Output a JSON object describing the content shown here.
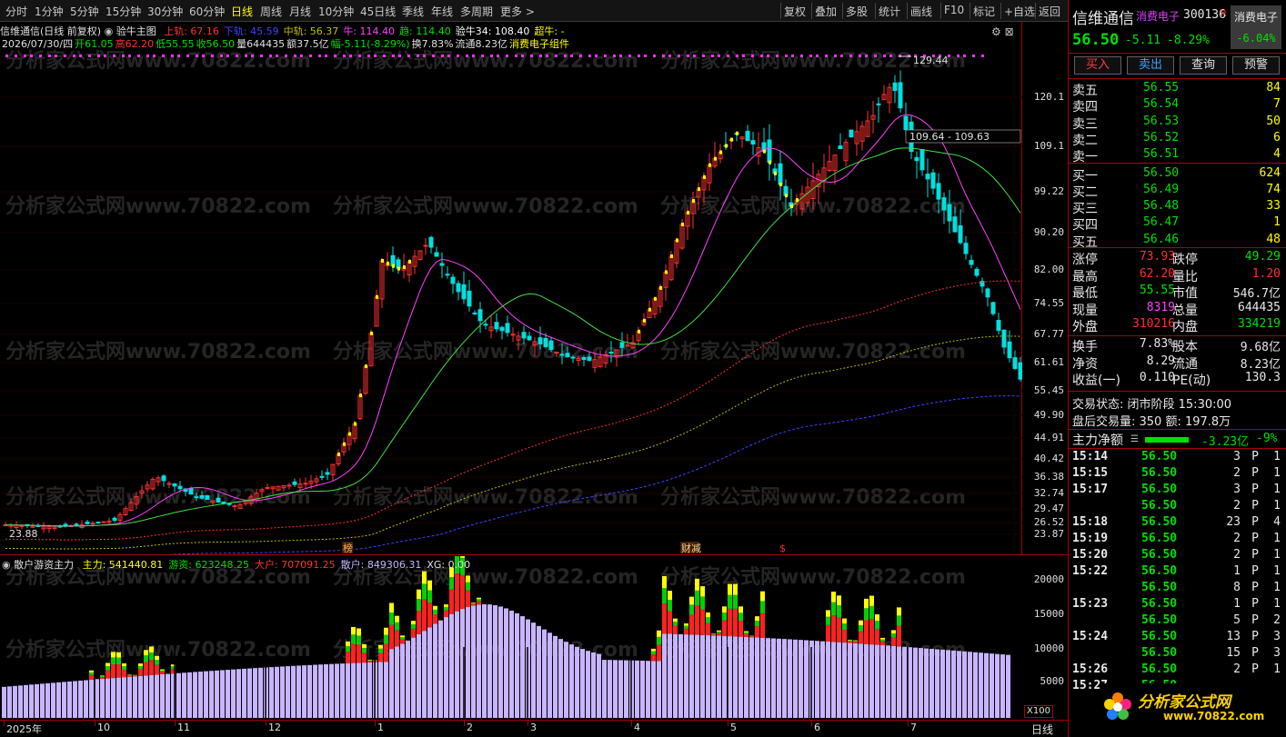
{
  "toolbar": {
    "tabs": [
      "分时",
      "1分钟",
      "5分钟",
      "15分钟",
      "30分钟",
      "60分钟",
      "日线",
      "周线",
      "月线",
      "10分钟",
      "45日线",
      "季线",
      "年线",
      "多周期",
      "更多 >"
    ],
    "active_tab": "日线",
    "right_buttons": [
      "复权",
      "叠加",
      "多股",
      "统计",
      "画线",
      "F10",
      "标记",
      "+自选",
      "返回"
    ]
  },
  "main_chart": {
    "title": "信维通信(日线 前复权)",
    "indicator_name": "验牛主图",
    "legend": [
      {
        "label": "上轨: 67.16",
        "color": "#ff3030"
      },
      {
        "label": "下轨: 45.59",
        "color": "#4040ff"
      },
      {
        "label": "中轨: 56.37",
        "color": "#c0c000"
      },
      {
        "label": "牛: 114.40",
        "color": "#ff40ff"
      },
      {
        "label": "趋: 114.40",
        "color": "#00e000"
      },
      {
        "label": "验牛34: 108.40",
        "color": "#ffffff"
      },
      {
        "label": "超牛: -",
        "color": "#ffff00"
      }
    ],
    "info_line": [
      {
        "text": "2026/07/30/四",
        "color": "#e0e0e0"
      },
      {
        "text": "开61.05",
        "color": "#00e000"
      },
      {
        "text": "高62.20",
        "color": "#ff3030"
      },
      {
        "text": "低55.55",
        "color": "#00e000"
      },
      {
        "text": "收56.50",
        "color": "#00e000"
      },
      {
        "text": "量644435",
        "color": "#e0e0e0"
      },
      {
        "text": "额37.5亿",
        "color": "#e0e0e0"
      },
      {
        "text": "幅-5.11(-8.29%)",
        "color": "#00e000"
      },
      {
        "text": "换7.83%",
        "color": "#e0e0e0"
      },
      {
        "text": "流通8.23亿",
        "color": "#e0e0e0"
      },
      {
        "text": "消费电子组件",
        "color": "#ffff00"
      }
    ],
    "y_ticks": [
      "120.1",
      "109.1",
      "99.22",
      "90.20",
      "82.00",
      "74.55",
      "67.77",
      "61.61",
      "55.45",
      "49.90",
      "44.91",
      "40.42",
      "36.38",
      "32.74",
      "29.47",
      "26.52",
      "23.87"
    ],
    "annotations": {
      "high": "129.44",
      "low": "23.88",
      "level": "109.64 - 109.63"
    },
    "markers": [
      "榜",
      "财减",
      "$"
    ]
  },
  "sub_chart": {
    "title": "散户游资主力",
    "legend": [
      {
        "label": "主力: 541440.81",
        "color": "#ffff00"
      },
      {
        "label": "游资: 623248.25",
        "color": "#00e000"
      },
      {
        "label": "大户: 707091.25",
        "color": "#ff3030"
      },
      {
        "label": "散户: 849306.31",
        "color": "#c8b4ff"
      },
      {
        "label": "XG: 0.00",
        "color": "#e0e0e0"
      }
    ],
    "y_ticks": [
      "20000",
      "15000",
      "10000",
      "5000"
    ],
    "unit": "X100"
  },
  "date_axis": {
    "labels": [
      "2025年",
      "10",
      "11",
      "12",
      "1",
      "2",
      "3",
      "4",
      "5",
      "6",
      "7"
    ],
    "period": "日线"
  },
  "watermark": "分析家公式网www.70822.com",
  "quote": {
    "name": "信维通信",
    "sector": "消费电子",
    "code": "300136",
    "badge": "R",
    "tag_name": "消费电子",
    "tag_change": "-6.04%",
    "price": "56.50",
    "change": "-5.11",
    "change_pct": "-8.29%",
    "buttons": [
      "买入",
      "卖出",
      "查询",
      "预警"
    ],
    "asks": [
      {
        "label": "卖五",
        "price": "56.55",
        "vol": "84"
      },
      {
        "label": "卖四",
        "price": "56.54",
        "vol": "7"
      },
      {
        "label": "卖三",
        "price": "56.53",
        "vol": "50"
      },
      {
        "label": "卖二",
        "price": "56.52",
        "vol": "6"
      },
      {
        "label": "卖一",
        "price": "56.51",
        "vol": "4"
      }
    ],
    "bids": [
      {
        "label": "买一",
        "price": "56.50",
        "vol": "624"
      },
      {
        "label": "买二",
        "price": "56.49",
        "vol": "74"
      },
      {
        "label": "买三",
        "price": "56.48",
        "vol": "33"
      },
      {
        "label": "买四",
        "price": "56.47",
        "vol": "1"
      },
      {
        "label": "买五",
        "price": "56.46",
        "vol": "48"
      }
    ],
    "stats": [
      {
        "l1": "涨停",
        "v1": "73.93",
        "c1": "#ff3030",
        "l2": "跌停",
        "v2": "49.29",
        "c2": "#00e000"
      },
      {
        "l1": "最高",
        "v1": "62.20",
        "c1": "#ff3030",
        "l2": "量比",
        "v2": "1.20",
        "c2": "#ff3030"
      },
      {
        "l1": "最低",
        "v1": "55.55",
        "c1": "#00e000",
        "l2": "市值",
        "v2": "546.7亿",
        "c2": "#e8e8e8"
      },
      {
        "l1": "现量",
        "v1": "8319",
        "c1": "#ff40ff",
        "l2": "总量",
        "v2": "644435",
        "c2": "#e8e8e8"
      },
      {
        "l1": "外盘",
        "v1": "310216",
        "c1": "#ff3030",
        "l2": "内盘",
        "v2": "334219",
        "c2": "#00e000"
      }
    ],
    "stats2": [
      {
        "l1": "换手",
        "v1": "7.83%",
        "c1": "#e8e8e8",
        "l2": "股本",
        "v2": "9.68亿",
        "c2": "#e8e8e8"
      },
      {
        "l1": "净资",
        "v1": "8.29",
        "c1": "#e8e8e8",
        "l2": "流通",
        "v2": "8.23亿",
        "c2": "#e8e8e8"
      },
      {
        "l1": "收益(一)",
        "v1": "0.110",
        "c1": "#e8e8e8",
        "l2": "PE(动)",
        "v2": "130.3",
        "c2": "#e8e8e8"
      }
    ],
    "trade_status": "交易状态: 闭市阶段 15:30:00",
    "after_hours": "盘后交易量: 350 额: 197.8万",
    "main_flow_label": "主力净额",
    "main_flow_value": "-3.23亿",
    "main_flow_pct": "-9%",
    "ticks": [
      {
        "t": "15:14",
        "p": "56.50",
        "v": "3",
        "s": "P",
        "n": "1"
      },
      {
        "t": "15:15",
        "p": "56.50",
        "v": "2",
        "s": "P",
        "n": "1"
      },
      {
        "t": "15:17",
        "p": "56.50",
        "v": "3",
        "s": "P",
        "n": "1"
      },
      {
        "t": "",
        "p": "56.50",
        "v": "2",
        "s": "P",
        "n": "1"
      },
      {
        "t": "15:18",
        "p": "56.50",
        "v": "23",
        "s": "P",
        "n": "4"
      },
      {
        "t": "15:19",
        "p": "56.50",
        "v": "2",
        "s": "P",
        "n": "1"
      },
      {
        "t": "15:20",
        "p": "56.50",
        "v": "2",
        "s": "P",
        "n": "1"
      },
      {
        "t": "15:22",
        "p": "56.50",
        "v": "1",
        "s": "P",
        "n": "1"
      },
      {
        "t": "",
        "p": "56.50",
        "v": "8",
        "s": "P",
        "n": "1"
      },
      {
        "t": "15:23",
        "p": "56.50",
        "v": "1",
        "s": "P",
        "n": "1"
      },
      {
        "t": "",
        "p": "56.50",
        "v": "5",
        "s": "P",
        "n": "2"
      },
      {
        "t": "15:24",
        "p": "56.50",
        "v": "13",
        "s": "P",
        "n": "3"
      },
      {
        "t": "",
        "p": "56.50",
        "v": "15",
        "s": "P",
        "n": "3"
      },
      {
        "t": "15:26",
        "p": "56.50",
        "v": "2",
        "s": "P",
        "n": "1"
      },
      {
        "t": "15:27",
        "p": "56.50",
        "v": "",
        "s": "",
        "n": ""
      }
    ],
    "logo_text": "分析家公式网",
    "logo_url_text": "www.70822.com"
  },
  "colors": {
    "up": "#ff3030",
    "down": "#00e0e0",
    "bg": "#000000",
    "frame": "#aa0000"
  }
}
